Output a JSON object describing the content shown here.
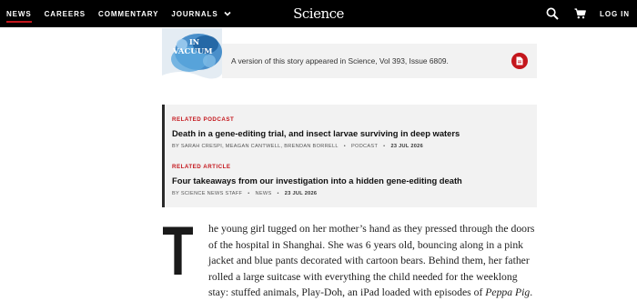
{
  "nav": {
    "items": [
      {
        "label": "NEWS",
        "active": true
      },
      {
        "label": "CAREERS",
        "active": false
      },
      {
        "label": "COMMENTARY",
        "active": false
      },
      {
        "label": "JOURNALS",
        "active": false,
        "has_dropdown": true
      }
    ],
    "logo": "Science",
    "login": "LOG IN",
    "icons": [
      "search-icon",
      "cart-icon",
      "chevron-down-icon"
    ],
    "accent_color": "#c4161c"
  },
  "issue": {
    "cover_text": "IN\nVACUUM",
    "text": "A version of this story appeared in Science, Vol 393, Issue 6809.",
    "pdf_icon": "pdf-icon"
  },
  "related": [
    {
      "tag": "RELATED PODCAST",
      "title": "Death in a gene-editing trial, and insect larvae surviving in deep waters",
      "byline": "BY SARAH CRESPI, MEAGAN CANTWELL, BRENDAN BORRELL",
      "type": "PODCAST",
      "date": "23 JUL 2026"
    },
    {
      "tag": "RELATED ARTICLE",
      "title": "Four takeaways from our investigation into a hidden gene-editing death",
      "byline": "BY SCIENCE NEWS STAFF",
      "type": "NEWS",
      "date": "23 JUL 2026"
    }
  ],
  "article": {
    "drop_cap": "T",
    "lines": [
      "he young girl tugged on her mother’s hand as they pressed through the doors",
      "of the hospital in Shanghai. She was 6 years old, bouncing along in a pink",
      "jacket and blue pants decorated with cartoon bears. Behind them, her father",
      "rolled a large suitcase with everything the child needed for the weeklong"
    ],
    "last_line_before": "stay: stuffed animals, Play-Doh, an iPad loaded with episodes of ",
    "last_line_em": "Peppa Pig",
    "last_line_after": "."
  }
}
